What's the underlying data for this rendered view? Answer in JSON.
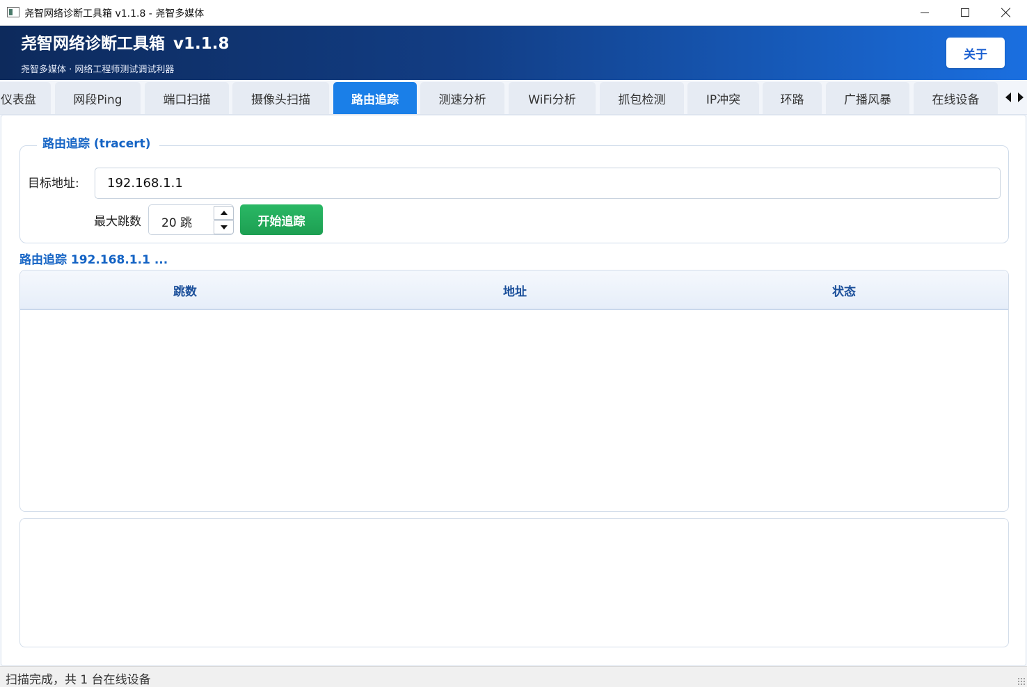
{
  "window": {
    "title": "尧智网络诊断工具箱 v1.1.8 - 尧智多媒体"
  },
  "header": {
    "title": "尧智网络诊断工具箱",
    "version": "v1.1.8",
    "subtitle": "尧智多媒体 · 网络工程师测试调试利器",
    "about_label": "关于"
  },
  "tabs": [
    {
      "label": "仪表盘",
      "active": false
    },
    {
      "label": "网段Ping",
      "active": false
    },
    {
      "label": "端口扫描",
      "active": false
    },
    {
      "label": "摄像头扫描",
      "active": false
    },
    {
      "label": "路由追踪",
      "active": true
    },
    {
      "label": "测速分析",
      "active": false
    },
    {
      "label": "WiFi分析",
      "active": false
    },
    {
      "label": "抓包检测",
      "active": false
    },
    {
      "label": "IP冲突",
      "active": false
    },
    {
      "label": "环路",
      "active": false
    },
    {
      "label": "广播风暴",
      "active": false
    },
    {
      "label": "在线设备",
      "active": false
    }
  ],
  "tracert": {
    "group_title": "路由追踪 (tracert)",
    "target_label": "目标地址:",
    "target_value": "192.168.1.1",
    "max_hops_label": "最大跳数",
    "max_hops_value": "20 跳",
    "start_label": "开始追踪",
    "progress_text": "路由追踪 192.168.1.1 ..."
  },
  "table": {
    "columns": [
      "跳数",
      "地址",
      "状态"
    ],
    "rows": []
  },
  "log": {
    "lines": []
  },
  "statusbar": {
    "text": "扫描完成，共 1 台在线设备"
  },
  "colors": {
    "accent": "#1a7fe8",
    "banner_start": "#0d2a5c",
    "banner_end": "#1a6fe0",
    "start_button": "#22ad5c",
    "heading_blue": "#1463c4"
  }
}
